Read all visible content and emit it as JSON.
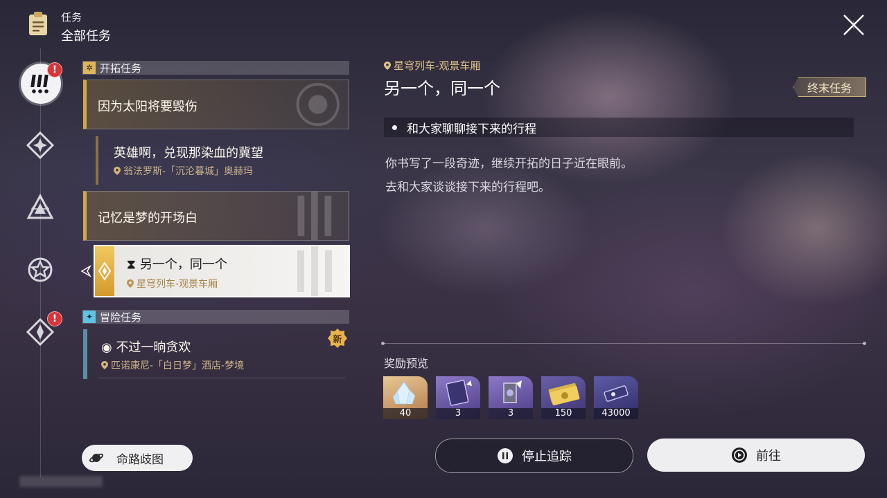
{
  "header": {
    "section": "任务",
    "title": "全部任务"
  },
  "rail": {
    "items": [
      {
        "name": "trailblaze",
        "badge": "!"
      },
      {
        "name": "companion"
      },
      {
        "name": "daily"
      },
      {
        "name": "event"
      },
      {
        "name": "adventure",
        "badge": "!"
      }
    ]
  },
  "categories": {
    "trailblaze": {
      "label": "开拓任务"
    },
    "adventure": {
      "label": "冒险任务"
    }
  },
  "quests": {
    "q1": {
      "title": "因为太阳将要毁伤"
    },
    "q1_sub": {
      "title": "英雄啊，兑现那染血的冀望",
      "location": "翁法罗斯-「沉沦暮城」奥赫玛"
    },
    "q2": {
      "title": "记忆是梦的开场白"
    },
    "q2_sub": {
      "title": "另一个，同一个",
      "location": "星穹列车-观景车厢"
    },
    "adv1": {
      "title": "不过一晌贪欢",
      "location": "匹诺康尼-「白日梦」酒店-梦境",
      "new_badge": "新"
    }
  },
  "route_button": {
    "label": "命路歧图"
  },
  "detail": {
    "location": "星穹列车-观景车厢",
    "title": "另一个，同一个",
    "tag": "终末任务",
    "objective": "和大家聊聊接下来的行程",
    "description_lines": [
      "你书写了一段奇迹，继续开拓的日子近在眼前。",
      "去和大家谈谈接下来的行程吧。"
    ],
    "rewards_label": "奖励预览",
    "rewards": [
      {
        "name": "crystal",
        "qty": "40"
      },
      {
        "name": "exp-book",
        "qty": "3"
      },
      {
        "name": "refine-material",
        "qty": "3"
      },
      {
        "name": "credits",
        "qty": "150"
      },
      {
        "name": "trailblaze-exp",
        "qty": "43000"
      }
    ]
  },
  "buttons": {
    "stop_tracking": "停止追踪",
    "go": "前往"
  }
}
